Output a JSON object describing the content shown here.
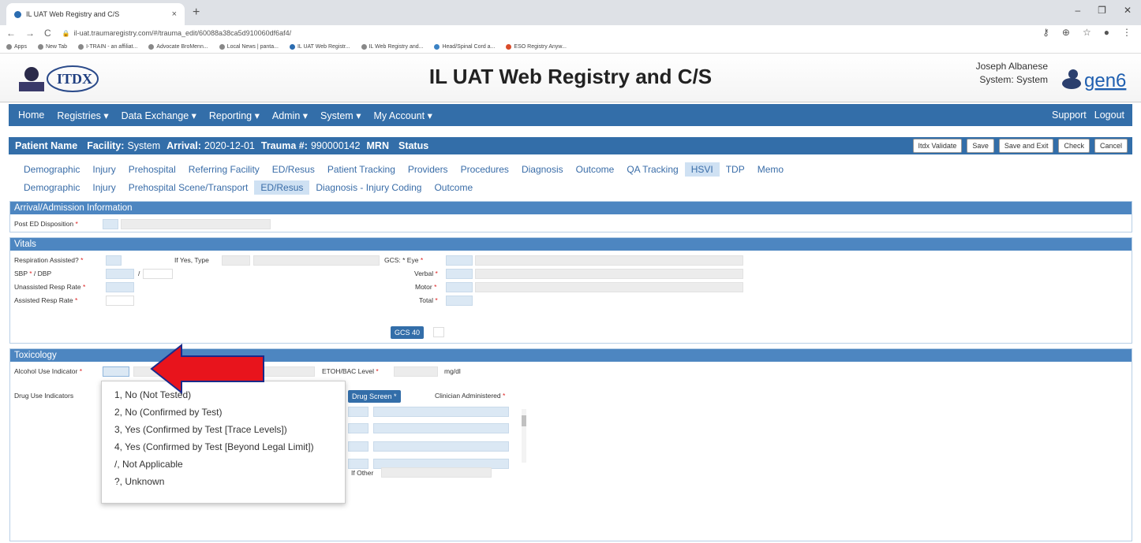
{
  "browser": {
    "tab_title": "IL UAT Web Registry and C/S",
    "tab_close": "×",
    "new_tab": "+",
    "url": "il-uat.traumaregistry.com/#/trauma_edit/60088a38ca5d910060df6af4/",
    "bookmarks": [
      "Apps",
      "New Tab",
      "I-TRAIN - an affiliat...",
      "Advocate BroMenn...",
      "Local News | panta...",
      "IL UAT Web Registr...",
      "IL Web Registry and...",
      "Head/Spinal Cord a...",
      "ESO Registry Anyw..."
    ]
  },
  "header": {
    "title": "IL UAT Web Registry and C/S",
    "user_name": "Joseph Albanese",
    "user_system": "System: System",
    "logo_left": "ITDX inside",
    "logo_right": "gen6"
  },
  "nav": {
    "items": [
      "Home",
      "Registries ▾",
      "Data Exchange ▾",
      "Reporting ▾",
      "Admin ▾",
      "System ▾",
      "My Account ▾"
    ],
    "support": "Support",
    "logout": "Logout"
  },
  "patient": {
    "name_label": "Patient Name",
    "facility_label": "Facility:",
    "facility_value": "System",
    "arrival_label": "Arrival:",
    "arrival_value": "2020-12-01",
    "trauma_label": "Trauma #:",
    "trauma_value": "990000142",
    "mrn_label": "MRN",
    "status_label": "Status",
    "buttons": [
      "Itdx Validate",
      "Save",
      "Save and Exit",
      "Check",
      "Cancel"
    ]
  },
  "tabs_main": [
    "Demographic",
    "Injury",
    "Prehospital",
    "Referring Facility",
    "ED/Resus",
    "Patient Tracking",
    "Providers",
    "Procedures",
    "Diagnosis",
    "Outcome",
    "QA Tracking",
    "HSVI",
    "TDP",
    "Memo"
  ],
  "tabs_sub": [
    "Demographic",
    "Injury",
    "Prehospital Scene/Transport",
    "ED/Resus",
    "Diagnosis - Injury Coding",
    "Outcome"
  ],
  "arrival": {
    "header": "Arrival/Admission Information",
    "post_ed": "Post ED Disposition"
  },
  "vitals": {
    "header": "Vitals",
    "resp_assisted": "Respiration Assisted?",
    "if_yes_type": "If Yes, Type",
    "sbp_dbp": "SBP",
    "dbp": "/ DBP",
    "slash": "/",
    "unassisted": "Unassisted Resp Rate",
    "assisted": "Assisted Resp Rate",
    "gcs_eye": "GCS: * Eye",
    "verbal": "Verbal",
    "motor": "Motor",
    "total": "Total",
    "gcs40": "GCS 40"
  },
  "tox": {
    "header": "Toxicology",
    "alcohol": "Alcohol Use Indicator",
    "etoh": "ETOH/BAC Level",
    "mgdl": "mg/dl",
    "drug_use": "Drug Use Indicators",
    "drug_screen": "Drug Screen",
    "clinician": "Clinician Administered",
    "if_other": "If Other",
    "options": [
      "1, No (Not Tested)",
      "2, No (Confirmed by Test)",
      "3, Yes (Confirmed by Test [Trace Levels])",
      "4, Yes (Confirmed by Test [Beyond Legal Limit])",
      "/, Not Applicable",
      "?, Unknown"
    ]
  },
  "colors": {
    "nav": "#336ea9",
    "section": "#4d86c1",
    "arrow": "#e8141c"
  }
}
